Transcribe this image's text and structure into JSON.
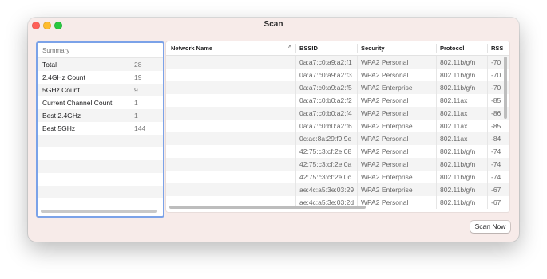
{
  "window": {
    "title": "Scan"
  },
  "summary": {
    "header": "Summary",
    "rows": [
      {
        "label": "Total",
        "value": "28"
      },
      {
        "label": "2.4GHz Count",
        "value": "19"
      },
      {
        "label": "5GHz Count",
        "value": "9"
      },
      {
        "label": "Current Channel Count",
        "value": "1"
      },
      {
        "label": "Best 2.4GHz",
        "value": "1"
      },
      {
        "label": "Best 5GHz",
        "value": "144"
      }
    ]
  },
  "networks": {
    "columns": [
      "Network Name",
      "BSSID",
      "Security",
      "Protocol",
      "RSS"
    ],
    "sort_column": "Network Name",
    "sort_icon": "chevron-up-icon",
    "rows": [
      {
        "name": "",
        "bssid": "0a:a7:c0:a9:a2:f1",
        "security": "WPA2 Personal",
        "protocol": "802.11b/g/n",
        "rss": "-70"
      },
      {
        "name": "",
        "bssid": "0a:a7:c0:a9:a2:f3",
        "security": "WPA2 Personal",
        "protocol": "802.11b/g/n",
        "rss": "-70"
      },
      {
        "name": "",
        "bssid": "0a:a7:c0:a9:a2:f5",
        "security": "WPA2 Enterprise",
        "protocol": "802.11b/g/n",
        "rss": "-70"
      },
      {
        "name": "",
        "bssid": "0a:a7:c0:b0:a2:f2",
        "security": "WPA2 Personal",
        "protocol": "802.11ax",
        "rss": "-85"
      },
      {
        "name": "",
        "bssid": "0a:a7:c0:b0:a2:f4",
        "security": "WPA2 Personal",
        "protocol": "802.11ax",
        "rss": "-86"
      },
      {
        "name": "",
        "bssid": "0a:a7:c0:b0:a2:f6",
        "security": "WPA2 Enterprise",
        "protocol": "802.11ax",
        "rss": "-85"
      },
      {
        "name": "",
        "bssid": "0c:ac:8a:29:f9:9e",
        "security": "WPA2 Personal",
        "protocol": "802.11ax",
        "rss": "-84"
      },
      {
        "name": "",
        "bssid": "42:75:c3:cf:2e:08",
        "security": "WPA2 Personal",
        "protocol": "802.11b/g/n",
        "rss": "-74"
      },
      {
        "name": "",
        "bssid": "42:75:c3:cf:2e:0a",
        "security": "WPA2 Personal",
        "protocol": "802.11b/g/n",
        "rss": "-74"
      },
      {
        "name": "",
        "bssid": "42:75:c3:cf:2e:0c",
        "security": "WPA2 Enterprise",
        "protocol": "802.11b/g/n",
        "rss": "-74"
      },
      {
        "name": "",
        "bssid": "ae:4c:a5:3e:03:29",
        "security": "WPA2 Enterprise",
        "protocol": "802.11b/g/n",
        "rss": "-67"
      },
      {
        "name": "",
        "bssid": "ae:4c:a5:3e:03:2d",
        "security": "WPA2 Personal",
        "protocol": "802.11b/g/n",
        "rss": "-67"
      }
    ]
  },
  "buttons": {
    "scan_now": "Scan Now"
  },
  "colors": {
    "window_bg": "#f7ebe9",
    "focus_ring": "#7ba2e8",
    "close": "#fe5f57",
    "minimize": "#febc2e",
    "zoom": "#28c840"
  }
}
